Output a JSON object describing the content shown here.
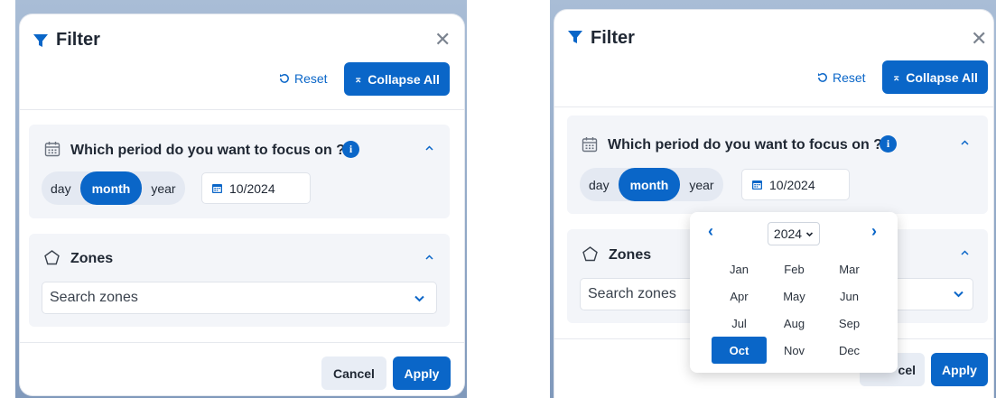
{
  "colors": {
    "accent": "#0a66c8",
    "section_bg": "#f3f5f9",
    "text": "#1f2733"
  },
  "panel1": {
    "title": "Filter",
    "reset_label": "Reset",
    "collapse_label": "Collapse All",
    "period": {
      "title": "Which period do you want to focus on ?",
      "seg": {
        "day": "day",
        "month": "month",
        "year": "year"
      },
      "date_value": "10/2024"
    },
    "zones": {
      "title": "Zones",
      "placeholder": "Search zones"
    },
    "cancel_label": "Cancel",
    "apply_label": "Apply"
  },
  "panel2": {
    "title": "Filter",
    "reset_label": "Reset",
    "collapse_label": "Collapse All",
    "period": {
      "title": "Which period do you want to focus on ?",
      "seg": {
        "day": "day",
        "month": "month",
        "year": "year"
      },
      "date_value": "10/2024"
    },
    "zones": {
      "title": "Zones",
      "placeholder": "Search zones"
    },
    "cancel_partial": "cel",
    "apply_label": "Apply"
  },
  "picker": {
    "year": "2024",
    "months": [
      "Jan",
      "Feb",
      "Mar",
      "Apr",
      "May",
      "Jun",
      "Jul",
      "Aug",
      "Sep",
      "Oct",
      "Nov",
      "Dec"
    ],
    "selected": "Oct"
  }
}
